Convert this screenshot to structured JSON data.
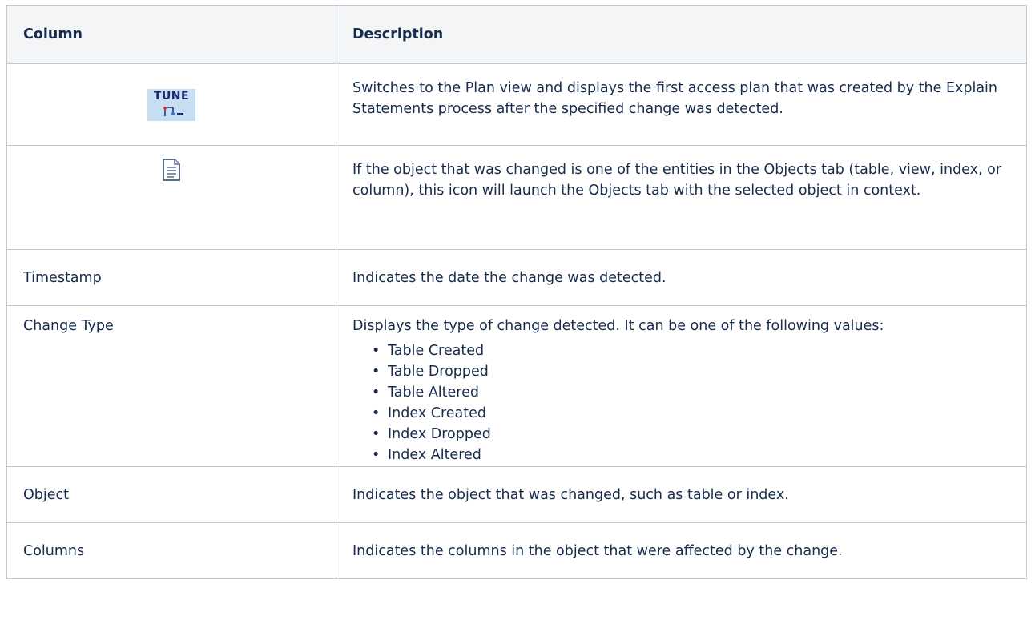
{
  "table": {
    "headers": {
      "column": "Column",
      "description": "Description"
    },
    "rows": [
      {
        "column_icon": "tune-icon",
        "icon_text": "TUNE",
        "description": "Switches to the Plan view and displays the first access plan that was created by the Explain Statements process after the specified change was detected."
      },
      {
        "column_icon": "document-icon",
        "description": "If the object that was changed is one of the entities in the Objects tab (table, view, index, or column), this icon will launch the Objects tab with the selected object in context."
      },
      {
        "column": "Timestamp",
        "description": "Indicates the date the change was detected."
      },
      {
        "column": "Change Type",
        "description": "Displays the type of change detected. It can be one of the following values:",
        "values": [
          "Table Created",
          "Table Dropped",
          "Table Altered",
          "Index Created",
          "Index Dropped",
          "Index Altered"
        ]
      },
      {
        "column": "Object",
        "description": "Indicates the object that was changed, such as table or index."
      },
      {
        "column": "Columns",
        "description": "Indicates the columns in the object that were affected by the change."
      }
    ]
  },
  "colors": {
    "header_bg": "#f4f5f7",
    "border": "#c1c7d0",
    "text": "#172b4d",
    "tune_icon_bg": "#c8dff3",
    "tune_icon_text": "#1a2a6e"
  }
}
